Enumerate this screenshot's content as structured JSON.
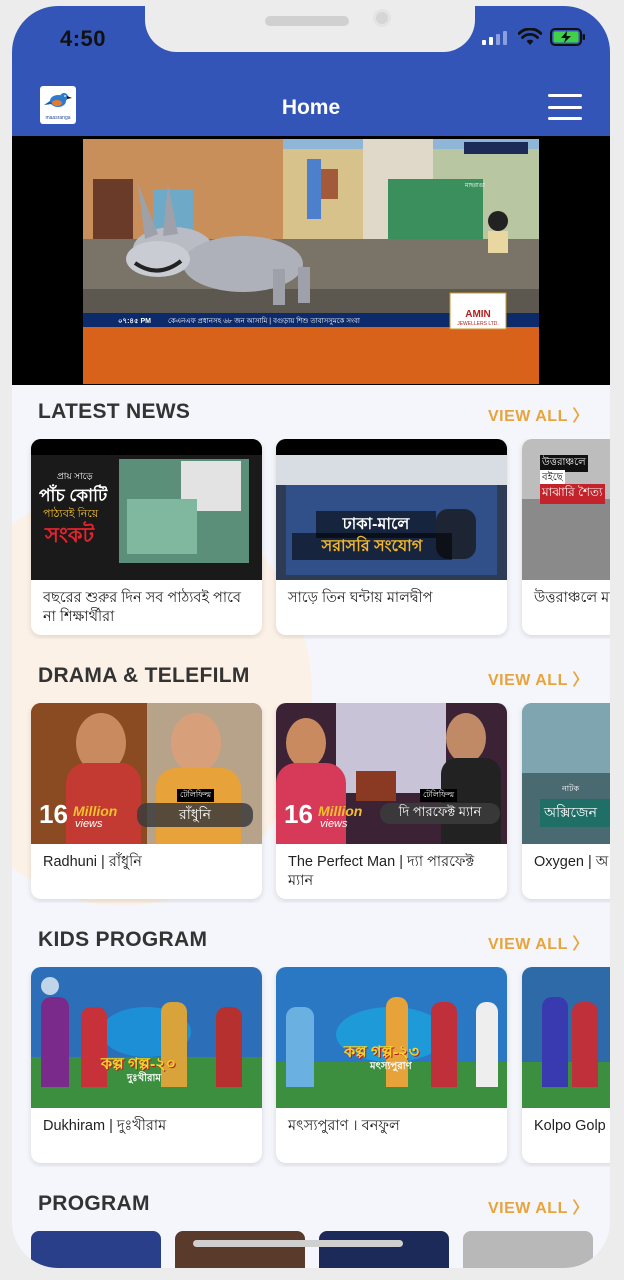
{
  "status_bar": {
    "time": "4:50"
  },
  "app_bar": {
    "title": "Home",
    "logo_text": "maasranga"
  },
  "player": {
    "ticker_time": "০৭:৪৫ PM",
    "ticker_text": "কেএনএফ প্রধানসহ ৬৮ জন আসামি  |  বগুড়ায় শিশু তাবাসসুমকে সংবা",
    "channel_tag": "মাছরাঙা",
    "sponsor": "AMIN",
    "sponsor_sub": "JEWELLERS LTD."
  },
  "sections": {
    "latest_news": {
      "title": "LATEST NEWS",
      "view_all": "VIEW ALL 〉",
      "items": [
        {
          "caption": "বছরের শুরুর দিন সব পাঠ্যবই পাবে না শিক্ষার্থীরা",
          "overlay_small": "প্রায় সাড়ে",
          "overlay_1": "পাঁচ কোটি",
          "overlay_2": "পাঠ্যবই নিয়ে",
          "overlay_3": "সংকট"
        },
        {
          "caption": "সাড়ে তিন ঘন্টায় মালদ্বীপ",
          "overlay_1": "ঢাকা-মালে",
          "overlay_2": "সরাসরি সংযোগ"
        },
        {
          "caption": "উত্তরাঞ্চলে মাঝারি থেকে",
          "overlay_1": "উত্তরাঞ্চলে",
          "overlay_2": "বইছে",
          "overlay_3": "মাঝারি শৈত্য"
        }
      ]
    },
    "drama": {
      "title": "DRAMA & TELEFILM",
      "view_all": "VIEW ALL 〉",
      "items": [
        {
          "caption": "Radhuni | রাঁধুনি",
          "views_num": "16",
          "views_word": "Million",
          "views_sub": "views",
          "tag": "টেলিফিল্ম",
          "name": "রাঁধুনি"
        },
        {
          "caption": "The Perfect Man | দ্যা পারফেক্ট ম্যান",
          "views_num": "16",
          "views_word": "Million",
          "views_sub": "views",
          "tag": "টেলিফিল্ম",
          "name": "দি পারফেক্ট ম্যান"
        },
        {
          "caption": "Oxygen | অ",
          "tag": "নাটক",
          "name": "অক্সিজেন"
        }
      ]
    },
    "kids": {
      "title": "KIDS PROGRAM",
      "view_all": "VIEW ALL 〉",
      "items": [
        {
          "caption": "Dukhiram | দুঃখীরাম",
          "series": "কল্প গল্প-২০",
          "name": "দুঃখীরাম"
        },
        {
          "caption": "মৎস্যপুরাণ । বনফুল",
          "series": "কল্প গল্প-২৩",
          "name": "মৎস্যপুরাণ"
        },
        {
          "caption": "Kolpo Golp"
        }
      ]
    },
    "program": {
      "title": "PROGRAM",
      "view_all": "VIEW ALL 〉"
    }
  },
  "colors": {
    "primary": "#3355b8",
    "accent": "#e8a43c"
  }
}
